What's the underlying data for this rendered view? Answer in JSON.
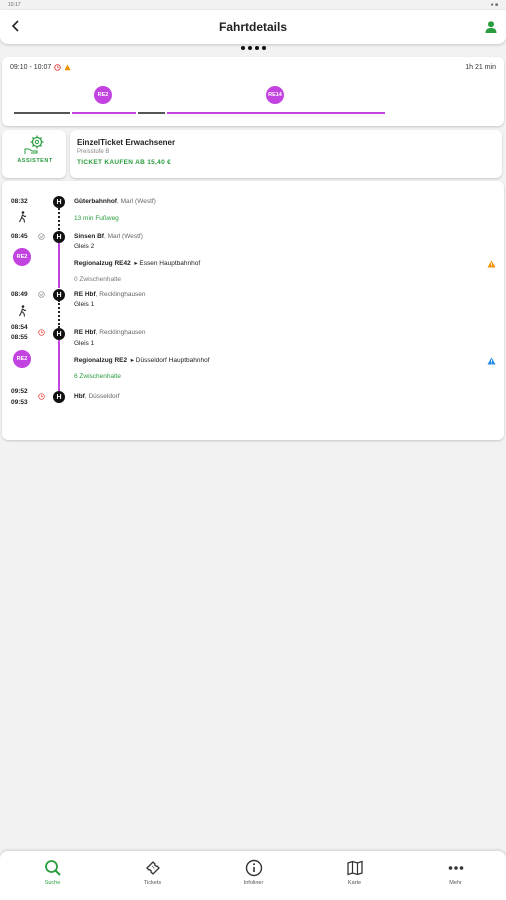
{
  "status_bar": {
    "left": "10:17",
    "right": "● ■"
  },
  "header": {
    "title": "Fahrtdetails"
  },
  "summary": {
    "time_range": "09:10 - 10:07",
    "duration": "1h 21 min",
    "lines": [
      {
        "label": "RE2",
        "color": "#c243e0"
      },
      {
        "label": "RE14",
        "color": "#c243e0"
      }
    ]
  },
  "assistant": {
    "label": "ASSISTENT"
  },
  "ticket": {
    "title": "EinzelTicket Erwachsener",
    "subtitle": "Preisstufe B",
    "buy_label": "TICKET KAUFEN AB 15,40 €"
  },
  "itinerary": {
    "stop1": {
      "time": "08:32",
      "name": "Güterbahnhof",
      "city": ", Marl (Westf)"
    },
    "walk1": {
      "text": "13 min Fußweg"
    },
    "stop2": {
      "time": "08:45",
      "name": "Sinsen Bf",
      "city": ", Marl (Westf)",
      "platform": "Gleis 2"
    },
    "leg1": {
      "line": "RE2",
      "train": "Regionalzug RE42",
      "direction": "Essen Hauptbahnhof",
      "stops": "0 Zwischenhalte"
    },
    "stop3": {
      "time": "08:49",
      "name": "RE Hbf",
      "city": ", Recklinghausen",
      "platform": "Gleis 1"
    },
    "stop4": {
      "time_arr": "08:54",
      "time_dep": "08:55",
      "name": "RE Hbf",
      "city": ", Recklinghausen",
      "platform": "Gleis 1"
    },
    "leg2": {
      "line": "RE2",
      "train": "Regionalzug RE2",
      "direction": "Düsseldorf Hauptbahnhof",
      "stops": "6 Zwischenhalte"
    },
    "stop5": {
      "time_arr": "09:52",
      "time_dep": "09:53",
      "name": "Hbf",
      "city": ", Düsseldorf"
    },
    "h_label": "H"
  },
  "nav": {
    "items": [
      {
        "label": "Suche",
        "icon": "search-icon"
      },
      {
        "label": "Tickets",
        "icon": "ticket-icon"
      },
      {
        "label": "Infoliner",
        "icon": "info-icon"
      },
      {
        "label": "Karte",
        "icon": "map-icon"
      },
      {
        "label": "Mehr",
        "icon": "more-icon"
      }
    ]
  },
  "colors": {
    "accent": "#2a9d3e",
    "line": "#c243e0",
    "warning": "#f29100",
    "info": "#1e88e5"
  }
}
